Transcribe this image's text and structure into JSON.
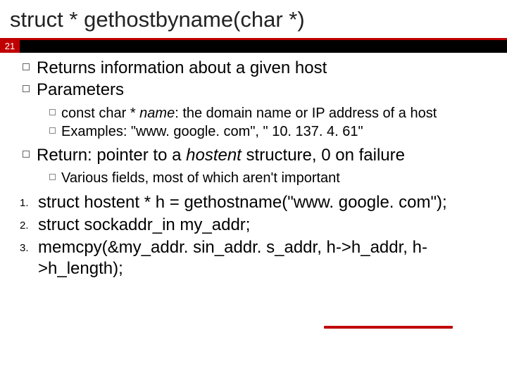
{
  "title": "struct * gethostbyname(char *)",
  "slide_number": "21",
  "bullets": [
    {
      "text": "Returns information about a given host"
    },
    {
      "text": "Parameters"
    }
  ],
  "subs1": [
    {
      "pre": "const char * ",
      "italic": "name",
      "post": ": the domain name or IP address of a host"
    },
    {
      "pre": "Examples: \"www. google. com\", \" 10. 137. 4. 61\"",
      "italic": "",
      "post": ""
    }
  ],
  "bullet3": {
    "pre": "Return: pointer to a ",
    "italic": "hostent",
    "post": " structure, 0 on failure"
  },
  "subs2": [
    {
      "pre": "Various fields, most of which aren't important",
      "italic": "",
      "post": ""
    }
  ],
  "numbered": [
    {
      "n": "1.",
      "text": "struct hostent * h = gethostname(\"www. google. com\");"
    },
    {
      "n": "2.",
      "text": "struct sockaddr_in my_addr;"
    },
    {
      "n": "3.",
      "text": "memcpy(&my_addr. sin_addr. s_addr, h->h_addr, h->h_length);"
    }
  ]
}
